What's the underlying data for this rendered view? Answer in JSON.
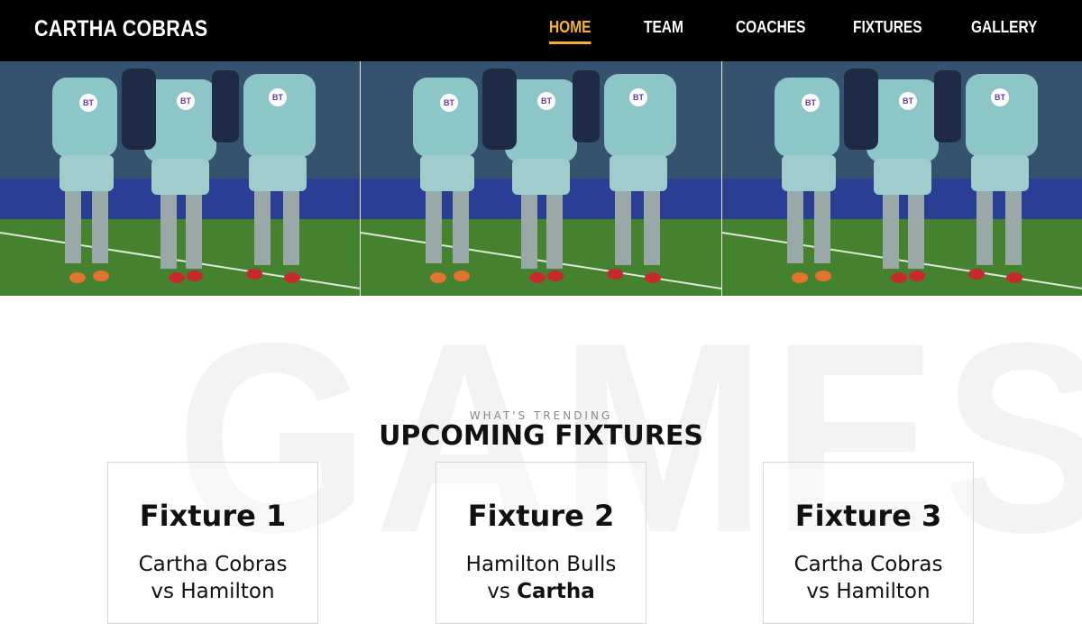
{
  "header": {
    "brand": "CARTHA COBRAS",
    "nav": [
      {
        "label": "HOME",
        "active": true
      },
      {
        "label": "TEAM",
        "active": false
      },
      {
        "label": "COACHES",
        "active": false
      },
      {
        "label": "FIXTURES",
        "active": false
      },
      {
        "label": "GALLERY",
        "active": false
      }
    ],
    "accent_color": "#f7b32b"
  },
  "hero": {
    "panels": [
      {
        "jersey_logo": "BT"
      },
      {
        "jersey_logo": "BT"
      },
      {
        "jersey_logo": "BT"
      }
    ]
  },
  "games": {
    "watermark": "GAMES",
    "kicker": "WHAT'S TRENDING",
    "title": "UPCOMING FIXTURES",
    "fixtures": [
      {
        "title": "Fixture 1",
        "line1": "Cartha Cobras",
        "line2_prefix": "vs ",
        "line2_team": "Hamilton"
      },
      {
        "title": "Fixture 2",
        "line1": "Hamilton Bulls",
        "line2_prefix": "vs ",
        "line2_team": "Cartha"
      },
      {
        "title": "Fixture 3",
        "line1": "Cartha Cobras",
        "line2_prefix": "vs ",
        "line2_team": "Hamilton"
      }
    ]
  }
}
